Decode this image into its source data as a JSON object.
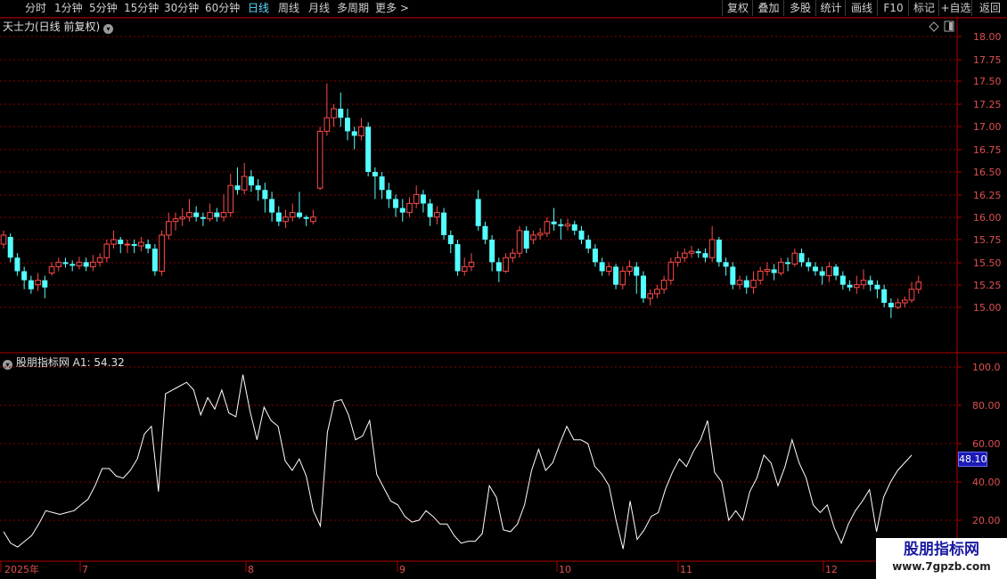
{
  "toolbar": {
    "periods": [
      "分时",
      "1分钟",
      "5分钟",
      "15分钟",
      "30分钟",
      "60分钟",
      "日线",
      "周线",
      "月线",
      "多周期",
      "更多 >"
    ],
    "active_period": "日线",
    "buttons": [
      "复权",
      "叠加",
      "多股",
      "统计",
      "画线",
      "F10",
      "标记",
      "+自选",
      "返回"
    ]
  },
  "main_chart": {
    "title": "天士力(日线 前复权)",
    "y_ticks": [
      "18.00",
      "17.75",
      "17.50",
      "17.25",
      "17.00",
      "16.75",
      "16.50",
      "16.25",
      "16.00",
      "15.75",
      "15.50",
      "15.25",
      "15.00"
    ],
    "y_min": 14.78,
    "y_max": 18.05
  },
  "indicator": {
    "title": "股朋指标网",
    "value_label": "A1: 54.32",
    "current_value": "48.10",
    "y_ticks": [
      "100.0",
      "80.00",
      "60.00",
      "40.00",
      "20.00"
    ]
  },
  "x_axis": {
    "labels": [
      "2025年",
      "7",
      "8",
      "9",
      "10",
      "11",
      "12"
    ]
  },
  "watermark": {
    "title": "股朋指标网",
    "url": "www.7gpzb.com"
  },
  "colors": {
    "up": "#ff4a4a",
    "down": "#54ffff",
    "grid": "#8a0000",
    "axis": "#b00000",
    "line": "#ffffff"
  },
  "chart_data": {
    "type": "candlestick",
    "ohlc": [
      [
        15.7,
        15.8,
        15.85,
        15.65
      ],
      [
        15.78,
        15.55,
        15.82,
        15.5
      ],
      [
        15.55,
        15.4,
        15.6,
        15.35
      ],
      [
        15.4,
        15.3,
        15.45,
        15.2
      ],
      [
        15.3,
        15.2,
        15.35,
        15.15
      ],
      [
        15.25,
        15.3,
        15.38,
        15.18
      ],
      [
        15.3,
        15.22,
        15.35,
        15.1
      ],
      [
        15.38,
        15.45,
        15.5,
        15.35
      ],
      [
        15.45,
        15.5,
        15.55,
        15.4
      ],
      [
        15.5,
        15.48,
        15.55,
        15.44
      ],
      [
        15.48,
        15.46,
        15.52,
        15.4
      ],
      [
        15.46,
        15.5,
        15.56,
        15.42
      ],
      [
        15.5,
        15.45,
        15.55,
        15.4
      ],
      [
        15.45,
        15.5,
        15.58,
        15.4
      ],
      [
        15.5,
        15.55,
        15.6,
        15.45
      ],
      [
        15.55,
        15.7,
        15.75,
        15.5
      ],
      [
        15.7,
        15.75,
        15.85,
        15.65
      ],
      [
        15.75,
        15.7,
        15.78,
        15.6
      ],
      [
        15.7,
        15.7,
        15.75,
        15.6
      ],
      [
        15.7,
        15.68,
        15.75,
        15.6
      ],
      [
        15.68,
        15.72,
        15.78,
        15.62
      ],
      [
        15.7,
        15.65,
        15.75,
        15.6
      ],
      [
        15.65,
        15.4,
        15.7,
        15.35
      ],
      [
        15.4,
        15.8,
        15.85,
        15.35
      ],
      [
        15.8,
        15.95,
        16.05,
        15.75
      ],
      [
        15.95,
        15.98,
        16.05,
        15.85
      ],
      [
        15.98,
        16.0,
        16.1,
        15.9
      ],
      [
        16.0,
        16.05,
        16.2,
        15.95
      ],
      [
        16.05,
        16.0,
        16.12,
        15.95
      ],
      [
        16.0,
        15.98,
        16.05,
        15.9
      ],
      [
        15.98,
        16.05,
        16.15,
        15.95
      ],
      [
        16.05,
        16.0,
        16.1,
        15.95
      ],
      [
        16.0,
        16.05,
        16.25,
        15.95
      ],
      [
        16.05,
        16.35,
        16.48,
        16.0
      ],
      [
        16.35,
        16.3,
        16.55,
        16.25
      ],
      [
        16.3,
        16.45,
        16.6,
        16.25
      ],
      [
        16.45,
        16.35,
        16.52,
        16.28
      ],
      [
        16.35,
        16.3,
        16.42,
        16.18
      ],
      [
        16.3,
        16.2,
        16.38,
        16.05
      ],
      [
        16.2,
        16.05,
        16.28,
        15.95
      ],
      [
        16.05,
        15.95,
        16.12,
        15.9
      ],
      [
        15.95,
        16.0,
        16.08,
        15.88
      ],
      [
        16.0,
        16.05,
        16.15,
        15.95
      ],
      [
        16.05,
        16.0,
        16.28,
        15.98
      ],
      [
        16.0,
        15.98,
        16.02,
        15.9
      ],
      [
        15.95,
        16.0,
        16.08,
        15.92
      ],
      [
        16.32,
        16.95,
        17.0,
        16.3
      ],
      [
        16.95,
        17.1,
        17.48,
        16.9
      ],
      [
        17.1,
        17.2,
        17.25,
        17.0
      ],
      [
        17.2,
        17.1,
        17.38,
        17.0
      ],
      [
        17.1,
        16.95,
        17.2,
        16.85
      ],
      [
        16.95,
        16.9,
        17.0,
        16.75
      ],
      [
        16.9,
        17.0,
        17.1,
        16.85
      ],
      [
        17.0,
        16.5,
        17.05,
        16.45
      ],
      [
        16.5,
        16.45,
        16.55,
        16.2
      ],
      [
        16.45,
        16.3,
        16.5,
        16.2
      ],
      [
        16.3,
        16.2,
        16.38,
        16.1
      ],
      [
        16.2,
        16.1,
        16.25,
        16.0
      ],
      [
        16.1,
        16.05,
        16.2,
        15.95
      ],
      [
        16.05,
        16.15,
        16.22,
        16.0
      ],
      [
        16.15,
        16.25,
        16.35,
        16.1
      ],
      [
        16.25,
        16.15,
        16.3,
        16.05
      ],
      [
        16.15,
        16.0,
        16.2,
        15.9
      ],
      [
        16.0,
        16.05,
        16.12,
        15.92
      ],
      [
        16.05,
        15.8,
        16.1,
        15.75
      ],
      [
        15.8,
        15.7,
        15.85,
        15.6
      ],
      [
        15.7,
        15.4,
        15.75,
        15.35
      ],
      [
        15.4,
        15.45,
        15.55,
        15.35
      ],
      [
        15.45,
        15.5,
        15.6,
        15.4
      ],
      [
        16.2,
        15.9,
        16.3,
        15.85
      ],
      [
        15.9,
        15.75,
        15.95,
        15.7
      ],
      [
        15.75,
        15.5,
        15.8,
        15.4
      ],
      [
        15.5,
        15.4,
        15.55,
        15.28
      ],
      [
        15.4,
        15.55,
        15.6,
        15.38
      ],
      [
        15.55,
        15.6,
        15.65,
        15.5
      ],
      [
        15.6,
        15.85,
        15.9,
        15.55
      ],
      [
        15.85,
        15.65,
        15.9,
        15.6
      ],
      [
        15.75,
        15.8,
        15.85,
        15.7
      ],
      [
        15.8,
        15.82,
        15.88,
        15.75
      ],
      [
        15.82,
        15.95,
        16.0,
        15.78
      ],
      [
        15.95,
        15.92,
        16.1,
        15.85
      ],
      [
        15.92,
        15.9,
        15.98,
        15.75
      ],
      [
        15.9,
        15.92,
        15.98,
        15.85
      ],
      [
        15.92,
        15.85,
        15.96,
        15.8
      ],
      [
        15.85,
        15.75,
        15.9,
        15.7
      ],
      [
        15.75,
        15.65,
        15.8,
        15.6
      ],
      [
        15.65,
        15.5,
        15.7,
        15.45
      ],
      [
        15.5,
        15.4,
        15.55,
        15.35
      ],
      [
        15.4,
        15.45,
        15.5,
        15.35
      ],
      [
        15.45,
        15.25,
        15.48,
        15.2
      ],
      [
        15.25,
        15.4,
        15.45,
        15.2
      ],
      [
        15.4,
        15.45,
        15.52,
        15.35
      ],
      [
        15.45,
        15.35,
        15.5,
        15.15
      ],
      [
        15.35,
        15.1,
        15.4,
        15.05
      ],
      [
        15.1,
        15.15,
        15.2,
        15.02
      ],
      [
        15.15,
        15.2,
        15.25,
        15.1
      ],
      [
        15.2,
        15.3,
        15.35,
        15.15
      ],
      [
        15.3,
        15.5,
        15.55,
        15.25
      ],
      [
        15.5,
        15.55,
        15.62,
        15.45
      ],
      [
        15.55,
        15.6,
        15.65,
        15.5
      ],
      [
        15.6,
        15.62,
        15.68,
        15.55
      ],
      [
        15.62,
        15.6,
        15.65,
        15.55
      ],
      [
        15.6,
        15.55,
        15.65,
        15.5
      ],
      [
        15.55,
        15.75,
        15.9,
        15.5
      ],
      [
        15.75,
        15.5,
        15.78,
        15.45
      ],
      [
        15.5,
        15.45,
        15.55,
        15.35
      ],
      [
        15.45,
        15.25,
        15.5,
        15.2
      ],
      [
        15.25,
        15.3,
        15.35,
        15.2
      ],
      [
        15.3,
        15.22,
        15.35,
        15.15
      ],
      [
        15.22,
        15.3,
        15.4,
        15.15
      ],
      [
        15.3,
        15.4,
        15.45,
        15.25
      ],
      [
        15.4,
        15.42,
        15.5,
        15.35
      ],
      [
        15.42,
        15.38,
        15.48,
        15.3
      ],
      [
        15.38,
        15.5,
        15.55,
        15.35
      ],
      [
        15.5,
        15.48,
        15.55,
        15.4
      ],
      [
        15.48,
        15.6,
        15.65,
        15.45
      ],
      [
        15.6,
        15.5,
        15.65,
        15.45
      ],
      [
        15.5,
        15.45,
        15.55,
        15.4
      ],
      [
        15.45,
        15.4,
        15.5,
        15.35
      ],
      [
        15.4,
        15.35,
        15.45,
        15.25
      ],
      [
        15.35,
        15.45,
        15.5,
        15.28
      ],
      [
        15.45,
        15.35,
        15.48,
        15.3
      ],
      [
        15.35,
        15.25,
        15.4,
        15.2
      ],
      [
        15.25,
        15.22,
        15.3,
        15.18
      ],
      [
        15.22,
        15.25,
        15.35,
        15.15
      ],
      [
        15.25,
        15.3,
        15.42,
        15.2
      ],
      [
        15.3,
        15.25,
        15.35,
        15.18
      ],
      [
        15.25,
        15.2,
        15.3,
        15.1
      ],
      [
        15.2,
        15.05,
        15.25,
        15.0
      ],
      [
        15.05,
        15.0,
        15.1,
        14.88
      ],
      [
        15.0,
        15.05,
        15.1,
        14.98
      ],
      [
        15.05,
        15.08,
        15.12,
        15.0
      ],
      [
        15.08,
        15.2,
        15.28,
        15.05
      ],
      [
        15.2,
        15.28,
        15.35,
        15.15
      ]
    ],
    "indicator_series": [
      14,
      8,
      6,
      9,
      12,
      18,
      25,
      24,
      23,
      24,
      25,
      28,
      31,
      38,
      47,
      47,
      43,
      42,
      46,
      52,
      65,
      69,
      35,
      86,
      88,
      90,
      92,
      88,
      75,
      84,
      78,
      88,
      76,
      74,
      96,
      77,
      62,
      79,
      72,
      69,
      51,
      46,
      52,
      43,
      25,
      17,
      66,
      82,
      83,
      75,
      62,
      64,
      72,
      44,
      37,
      30,
      28,
      22,
      19,
      20,
      25,
      22,
      18,
      18,
      12,
      8,
      9,
      9,
      13,
      38,
      32,
      15,
      14,
      18,
      28,
      46,
      57,
      46,
      50,
      60,
      69,
      62,
      62,
      60,
      48,
      44,
      38,
      20,
      5,
      30,
      10,
      15,
      22,
      24,
      36,
      45,
      52,
      48,
      56,
      62,
      72,
      45,
      40,
      20,
      25,
      20,
      35,
      42,
      54,
      50,
      38,
      48,
      62,
      50,
      42,
      28,
      24,
      28,
      16,
      8,
      18,
      25,
      30,
      36,
      14,
      32,
      40,
      46,
      50,
      54
    ]
  }
}
